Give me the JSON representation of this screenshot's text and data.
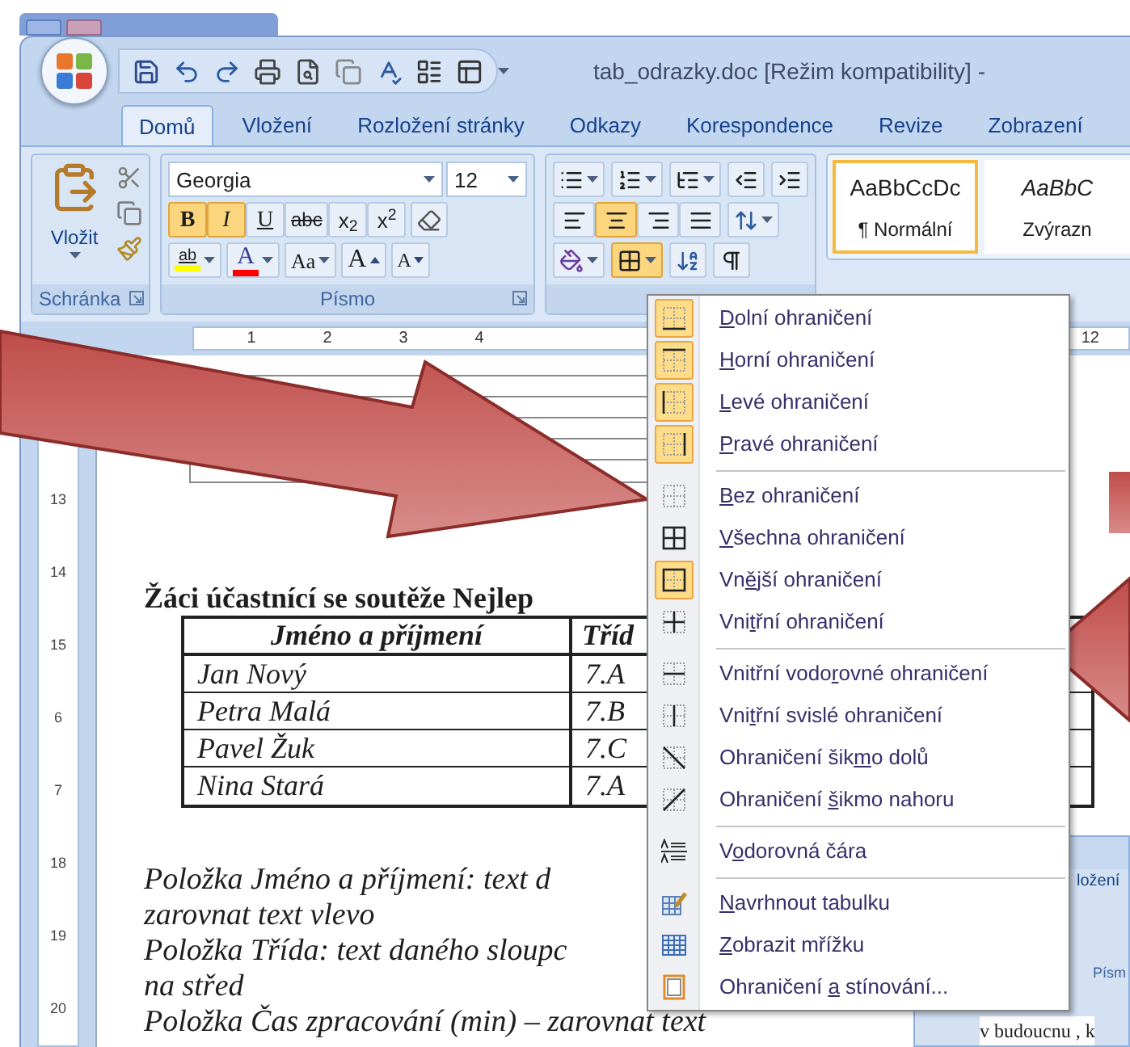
{
  "window": {
    "title": "tab_odrazky.doc [Režim kompatibility] -"
  },
  "tabs": [
    {
      "label": "Domů",
      "selected": true
    },
    {
      "label": "Vložení",
      "selected": false
    },
    {
      "label": "Rozložení stránky",
      "selected": false
    },
    {
      "label": "Odkazy",
      "selected": false
    },
    {
      "label": "Korespondence",
      "selected": false
    },
    {
      "label": "Revize",
      "selected": false
    },
    {
      "label": "Zobrazení",
      "selected": false
    }
  ],
  "clipboard": {
    "paste": "Vložit",
    "label": "Schránka"
  },
  "font": {
    "name": "Georgia",
    "size": "12",
    "label": "Písmo",
    "format_buttons": [
      {
        "kind": "bold",
        "text": "B",
        "on": true
      },
      {
        "kind": "italic",
        "text": "I",
        "on": true
      },
      {
        "kind": "underline",
        "text": "U",
        "on": false
      },
      {
        "kind": "strike",
        "text": "abc",
        "on": false
      },
      {
        "kind": "sub",
        "text": "x$_{2}$",
        "on": false
      },
      {
        "kind": "sup",
        "text": "x$^{2}$",
        "on": false
      }
    ],
    "tools": [
      {
        "kind": "highlight",
        "text": "ab"
      },
      {
        "kind": "color",
        "text": "A"
      },
      {
        "kind": "case",
        "text": "Aa"
      },
      {
        "kind": "grow",
        "text": "A"
      },
      {
        "kind": "shrink",
        "text": "A"
      }
    ]
  },
  "paragraph": {
    "align": [
      {
        "kind": "left",
        "on": false
      },
      {
        "kind": "center",
        "on": true
      },
      {
        "kind": "right",
        "on": false
      },
      {
        "kind": "justify",
        "on": false
      }
    ],
    "borders_button": {
      "on": true
    }
  },
  "styles": [
    {
      "preview": "AaBbCcDc",
      "name": "¶ Normální",
      "selected": true
    },
    {
      "preview": "AaBbC",
      "name": "Zvýrazn",
      "selected": false
    }
  ],
  "ruler": {
    "marks": [
      "1",
      "2",
      "3",
      "4"
    ],
    "right_mark": "12",
    "vertical_marks": [
      "13",
      "14",
      "15",
      "6",
      "7",
      "18",
      "19",
      "20"
    ]
  },
  "document": {
    "heading": "Žáci účastnící se soutěže Nejlep",
    "table": {
      "columns": [
        "Jméno a příjmení",
        "Tříd"
      ],
      "rows": [
        [
          "Jan Nový",
          "7.A"
        ],
        [
          "Petra Malá",
          "7.B"
        ],
        [
          "Pavel Žuk",
          "7.C"
        ],
        [
          "Nina Stará",
          "7.A"
        ]
      ]
    },
    "lines": [
      "Položka Jméno a příjmení: text d",
      "zarovnat text vlevo",
      "Položka Třída: text daného sloupc",
      "na střed",
      "Položka Čas zpracování (min) – zarovnat text"
    ]
  },
  "menu": {
    "groups": [
      [
        {
          "key": "D",
          "after": "olní ohraničení",
          "kind": "bottom",
          "checked": true
        },
        {
          "key": "H",
          "after": "orní ohraničení",
          "kind": "top",
          "checked": true
        },
        {
          "key": "L",
          "after": "evé ohraničení",
          "kind": "left",
          "checked": true
        },
        {
          "key": "P",
          "after": "ravé ohraničení",
          "kind": "right",
          "checked": true
        }
      ],
      [
        {
          "key": "B",
          "after": "ez ohraničení",
          "kind": "none",
          "checked": false
        },
        {
          "key": "V",
          "after": "šechna ohraničení",
          "kind": "all",
          "checked": false
        },
        {
          "before": "Vn",
          "key": "ě",
          "after": "jší ohraničení",
          "kind": "outside",
          "checked": true
        },
        {
          "before": "Vni",
          "key": "t",
          "after": "řní ohraničení",
          "kind": "inside",
          "checked": false
        }
      ],
      [
        {
          "before": "Vnitřní vodo",
          "key": "r",
          "after": "ovné ohraničení",
          "kind": "inside_h",
          "checked": false
        },
        {
          "before": "Vni",
          "key": "t",
          "after": "řní svislé ohraničení",
          "kind": "inside_v",
          "checked": false
        },
        {
          "before": "Ohraničení šik",
          "key": "m",
          "after": "o dolů",
          "kind": "diag_down",
          "checked": false
        },
        {
          "before": "Ohraničení ",
          "key": "š",
          "after": "ikmo nahoru",
          "kind": "diag_up",
          "checked": false
        }
      ],
      [
        {
          "before": "V",
          "key": "o",
          "after": "dorovná čára",
          "kind": "hline",
          "checked": false
        }
      ],
      [
        {
          "key": "N",
          "after": "avrhnout tabulku",
          "kind": "draw",
          "checked": false
        },
        {
          "key": "Z",
          "after": "obrazit mřížku",
          "kind": "grid",
          "checked": false
        },
        {
          "before": "Ohraničení ",
          "key": "a",
          "after": " stínování...",
          "kind": "dialog",
          "checked": false
        }
      ]
    ]
  },
  "inset": {
    "tab": "ložení",
    "group": "Písm",
    "text": "v budoucnu , k"
  }
}
